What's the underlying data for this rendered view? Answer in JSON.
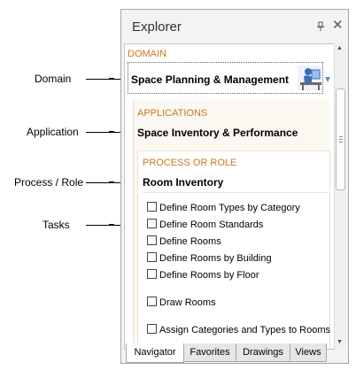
{
  "callouts": {
    "domain": "Domain",
    "application": "Application",
    "process_role": "Process / Role",
    "tasks": "Tasks"
  },
  "explorer": {
    "title": "Explorer",
    "domain": {
      "label": "DOMAIN",
      "name": "Space Planning & Management",
      "icon": "person-at-desk-icon"
    },
    "application": {
      "label": "APPLICATIONS",
      "name": "Space Inventory & Performance"
    },
    "process": {
      "label": "PROCESS OR ROLE",
      "name": "Room Inventory"
    },
    "tasks": [
      "Define Room Types by Category",
      "Define Room Standards",
      "Define Rooms",
      "Define Rooms by Building",
      "Define Rooms by Floor",
      "Draw Rooms",
      "Assign Categories and Types to Rooms"
    ],
    "tabs": [
      "Navigator",
      "Favorites",
      "Drawings",
      "Views"
    ],
    "active_tab": "Navigator"
  },
  "colors": {
    "section_label": "#c8781e",
    "dropdown_arrow": "#6a8fc0"
  }
}
